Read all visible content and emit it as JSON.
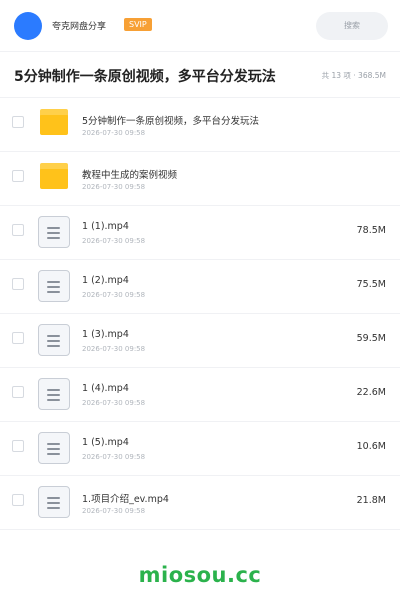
{
  "header": {
    "share_title": "夸克网盘分享",
    "badge": "SVIP",
    "search_placeholder": "搜索",
    "accent_color": "#2b7bff",
    "badge_color": "#f7a035"
  },
  "folder": {
    "title": "5分钟制作一条原创视频，多平台分发玩法",
    "meta": "共 13 项 · 368.5M"
  },
  "files": [
    {
      "icon": "folder-icon",
      "name": "5分钟制作一条原创视频，多平台分发玩法",
      "date": "2026-07-30 09:58",
      "size": ""
    },
    {
      "icon": "folder-icon",
      "name": "教程中生成的案例视频",
      "date": "2026-07-30 09:58",
      "size": ""
    },
    {
      "icon": "document-icon",
      "name": "1 (1).mp4",
      "date": "2026-07-30 09:58",
      "size": "78.5M"
    },
    {
      "icon": "document-icon",
      "name": "1 (2).mp4",
      "date": "2026-07-30 09:58",
      "size": "75.5M"
    },
    {
      "icon": "document-icon",
      "name": "1 (3).mp4",
      "date": "2026-07-30 09:58",
      "size": "59.5M"
    },
    {
      "icon": "document-icon",
      "name": "1 (4).mp4",
      "date": "2026-07-30 09:58",
      "size": "22.6M"
    },
    {
      "icon": "document-icon",
      "name": "1 (5).mp4",
      "date": "2026-07-30 09:58",
      "size": "10.6M"
    },
    {
      "icon": "document-icon",
      "name": "1.项目介绍_ev.mp4",
      "date": "2026-07-30 09:58",
      "size": "21.8M"
    }
  ],
  "watermark": "miosou.cc"
}
